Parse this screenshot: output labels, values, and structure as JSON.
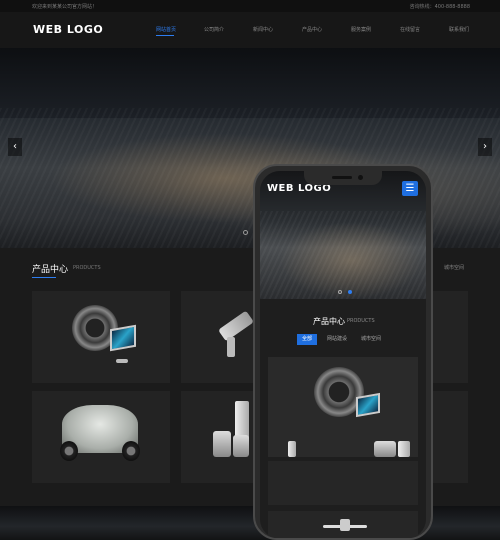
{
  "topbar": {
    "left_text": "欢迎来到某某公司官方网站！",
    "right_text": "咨询热线：400-888-8888"
  },
  "header": {
    "logo": "WEB LOGO",
    "nav": [
      "网站首页",
      "公司简介",
      "新闻中心",
      "产品中心",
      "服务案例",
      "在线留言",
      "联系我们"
    ],
    "active_index": 0
  },
  "hero": {
    "prev_glyph": "‹",
    "next_glyph": "›"
  },
  "products": {
    "title": "产品中心",
    "subtitle": "PRODUCTS",
    "more": "城市空间"
  },
  "phone": {
    "logo": "WEB LOGO",
    "menu_glyph": "☰",
    "products_title": "产品中心",
    "products_subtitle": "PRODUCTS",
    "tabs": [
      "全部",
      "网站建设",
      "城市空间"
    ],
    "active_tab": 0
  },
  "colors": {
    "accent": "#2e7df0",
    "background": "#151515",
    "card": "#232323"
  },
  "icons": [
    "tire-monitor-product",
    "camera-product",
    "vintage-car-product",
    "computer-speaker-product",
    "menu-icon",
    "chevron-left-icon",
    "chevron-right-icon"
  ]
}
